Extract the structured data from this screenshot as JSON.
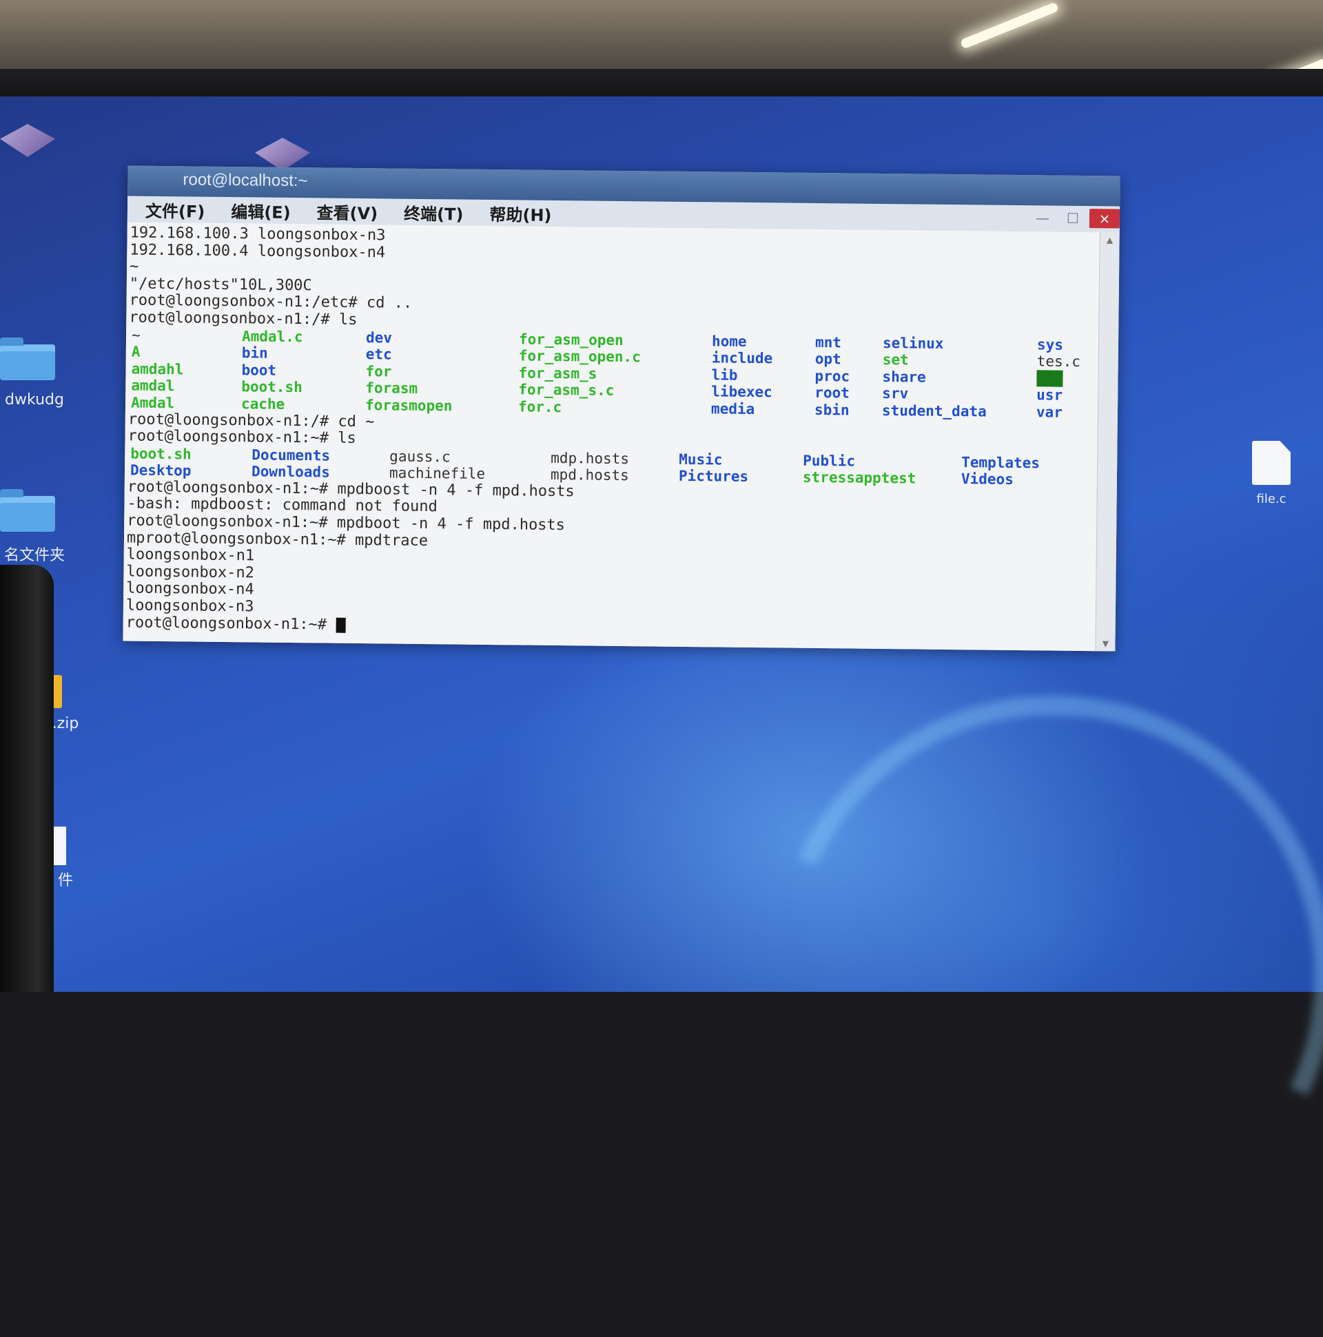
{
  "window": {
    "title": "root@localhost:~",
    "close_label": "×",
    "min_label": "—",
    "max_label": "☐"
  },
  "menu": [
    "文件(F)",
    "编辑(E)",
    "查看(V)",
    "终端(T)",
    "帮助(H)"
  ],
  "terminal": {
    "pre_lines": [
      "192.168.100.3 loongsonbox-n3",
      "192.168.100.4 loongsonbox-n4",
      "~",
      "\"/etc/hosts\"10L,300C",
      "root@loongsonbox-n1:/etc# cd ..",
      "root@loongsonbox-n1:/# ls"
    ],
    "root_listing": {
      "columns": [
        [
          "~",
          "A",
          "amdahl",
          "amdal",
          "Amdal"
        ],
        [
          "Amdal.c",
          "bin",
          "boot",
          "boot.sh",
          "cache"
        ],
        [
          "dev",
          "etc",
          "for",
          "forasm",
          "forasmopen"
        ],
        [
          "for_asm_open",
          "for_asm_open.c",
          "for_asm_s",
          "for_asm_s.c",
          "for.c"
        ],
        [
          "home",
          "include",
          "lib",
          "libexec",
          "media"
        ],
        [
          "mnt",
          "opt",
          "proc",
          "root",
          "sbin"
        ],
        [
          "selinux",
          "set",
          "share",
          "srv",
          "student_data"
        ],
        [
          "sys",
          "tes.c",
          "tmp",
          "usr",
          "var"
        ]
      ]
    },
    "mid_lines": [
      "root@loongsonbox-n1:/# cd ~",
      "root@loongsonbox-n1:~# ls"
    ],
    "home_listing": {
      "columns": [
        [
          "boot.sh",
          "Desktop"
        ],
        [
          "Documents",
          "Downloads"
        ],
        [
          "gauss.c",
          "machinefile"
        ],
        [
          "mdp.hosts",
          "mpd.hosts"
        ],
        [
          "Music",
          "Pictures"
        ],
        [
          "Public",
          "stressapptest"
        ],
        [
          "Templates",
          "Videos"
        ]
      ]
    },
    "post_lines": [
      "root@loongsonbox-n1:~# mpdboost -n 4 -f mpd.hosts",
      "-bash: mpdboost: command not found",
      "root@loongsonbox-n1:~# mpdboot -n 4 -f mpd.hosts",
      "mproot@loongsonbox-n1:~# mpdtrace",
      "loongsonbox-n1",
      "loongsonbox-n2",
      "loongsonbox-n4",
      "loongsonbox-n3"
    ],
    "prompt": "root@loongsonbox-n1:~# "
  },
  "desktop": {
    "icons": [
      "dwkudg",
      "名文件夹",
      ".zip",
      "件",
      "file.c"
    ]
  },
  "colors": {
    "green": "#2fb82a",
    "blue": "#1f4fd1",
    "titlebar": "#3d5f93",
    "close": "#c9323a"
  }
}
